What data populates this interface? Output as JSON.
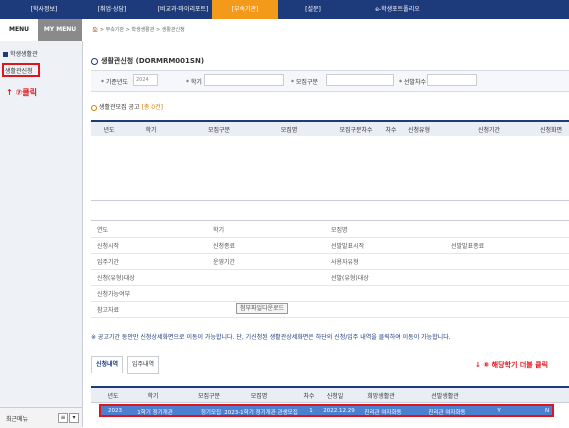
{
  "topnav": {
    "tabs": [
      {
        "label": "[학사정보]"
      },
      {
        "label": "[취업·상담]"
      },
      {
        "label": "[비교과·마이리포트]"
      },
      {
        "label": "[부속기관]"
      },
      {
        "label": "[설문]"
      },
      {
        "label": "e-학생포트폴리오"
      }
    ]
  },
  "menubar": {
    "menu": "MENU",
    "my_menu": "MY MENU"
  },
  "sidebar": {
    "title": "학생생활관",
    "item": "생활관신청",
    "note": "↑ ⑦클릭",
    "bottom_label": "최근메뉴"
  },
  "breadcrumb": "🏠 > 부속기관 > 학생생활관 > 생활관신청",
  "page_title": "생활관신청 (DORMRM001SN)",
  "filter": {
    "year_label": "* 기준년도",
    "year_value": "2024",
    "semester_label": "* 학기",
    "recruit_label": "* 모집구분",
    "order_label": "* 선발차수"
  },
  "notice_section": {
    "label": "생활관모집 공고",
    "count": "[총 0건]"
  },
  "notice_grid": {
    "headers": [
      "년도",
      "학기",
      "모집구분",
      "모집명",
      "모집구분차수",
      "차수",
      "신청유형",
      "신청기간",
      "신청화면"
    ]
  },
  "detail": {
    "year": "연도",
    "semester": "학기",
    "recruit_name": "모집명",
    "apply_start": "신청시작",
    "apply_end": "신청종료",
    "select_announce_start": "선발발표시작",
    "select_announce_end": "선발발표종료",
    "move_in": "입주기간",
    "operate": "운영기간",
    "use_type": "사용자유형",
    "apply_target": "신청(유형)대상",
    "select_target": "선발(유형)대상",
    "apply_available": "신청가능여부",
    "reference": "참고자료",
    "download_button": "첨부파일다운로드"
  },
  "notice_text": "※ 공고기간 동안만 신청상세화면으로 이동이 가능합니다.  단, 기신청된 생활관상세화면은 하단의 신청/입주 내역을 클릭하여 이동이 가능합니다.",
  "subtabs": [
    "신청내역",
    "입주내역"
  ],
  "history_grid": {
    "headers": [
      "년도",
      "학기",
      "모집구분",
      "모집명",
      "차수",
      "신청일",
      "희망생활관",
      "선발생활관"
    ],
    "row": [
      "2023",
      "1학기 정기개관",
      "정기모집",
      "2023-1학기 정기개관 관생모집",
      "1",
      "2022.12.29",
      "진리관 여자화동",
      "진리관 여자화동",
      "Y",
      "N"
    ]
  },
  "annotation": "↓ ⑧ 해당학기 더블 클릭"
}
